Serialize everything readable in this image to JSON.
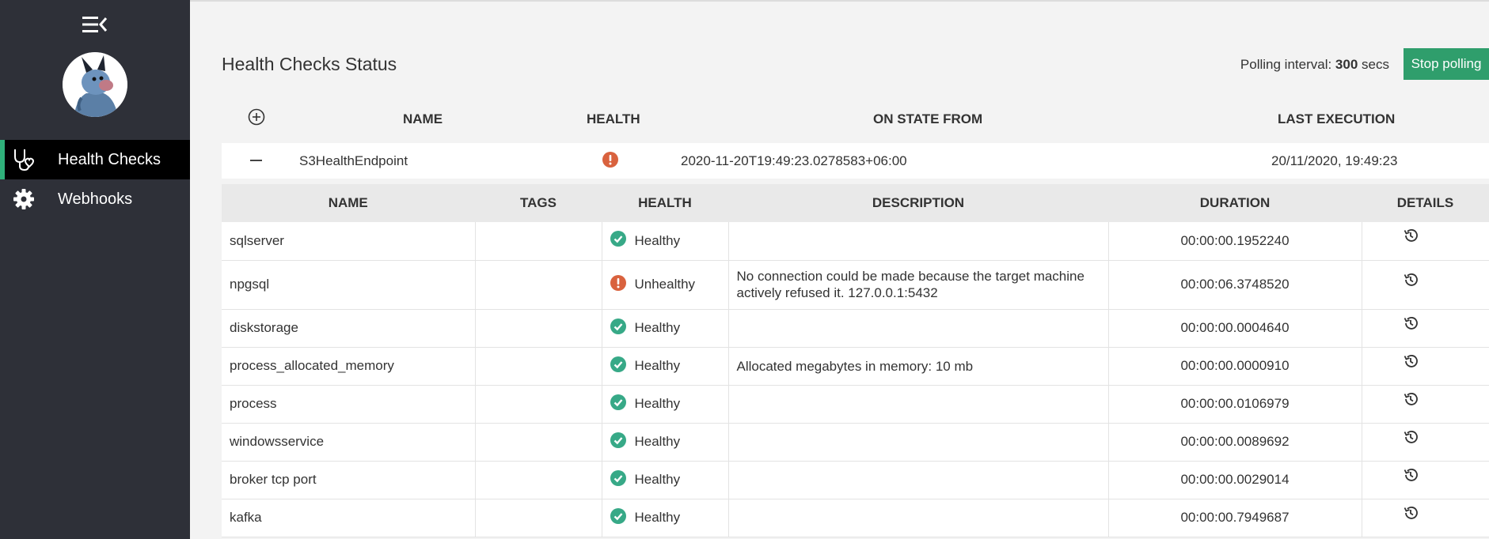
{
  "sidebar": {
    "menu_icon": "menu-collapse-icon",
    "avatar_icon": "avatar-mascot",
    "items": [
      {
        "label": "Health Checks",
        "icon": "stethoscope-icon",
        "active": true
      },
      {
        "label": "Webhooks",
        "icon": "gear-icon",
        "active": false
      }
    ]
  },
  "header": {
    "title": "Health Checks Status",
    "polling_label": "Polling interval:",
    "polling_value": "300",
    "polling_unit": "secs",
    "stop_button": "Stop polling"
  },
  "columns": {
    "name": "NAME",
    "health": "HEALTH",
    "on_state_from": "ON STATE FROM",
    "last_execution": "LAST EXECUTION"
  },
  "endpoint": {
    "name": "S3HealthEndpoint",
    "health_icon": "error-icon",
    "on_state_from": "2020-11-20T19:49:23.0278583+06:00",
    "last_execution": "20/11/2020, 19:49:23"
  },
  "detail": {
    "headers": {
      "name": "NAME",
      "tags": "TAGS",
      "health": "HEALTH",
      "description": "DESCRIPTION",
      "duration": "DURATION",
      "details": "DETAILS"
    },
    "rows": [
      {
        "name": "sqlserver",
        "tags": "",
        "health": "Healthy",
        "description": "",
        "duration": "00:00:00.1952240"
      },
      {
        "name": "npgsql",
        "tags": "",
        "health": "Unhealthy",
        "description": "No connection could be made because the target machine actively refused it. 127.0.0.1:5432",
        "duration": "00:00:06.3748520"
      },
      {
        "name": "diskstorage",
        "tags": "",
        "health": "Healthy",
        "description": "",
        "duration": "00:00:00.0004640"
      },
      {
        "name": "process_allocated_memory",
        "tags": "",
        "health": "Healthy",
        "description": "Allocated megabytes in memory: 10 mb",
        "duration": "00:00:00.0000910"
      },
      {
        "name": "process",
        "tags": "",
        "health": "Healthy",
        "description": "",
        "duration": "00:00:00.0106979"
      },
      {
        "name": "windowsservice",
        "tags": "",
        "health": "Healthy",
        "description": "",
        "duration": "00:00:00.0089692"
      },
      {
        "name": "broker tcp port",
        "tags": "",
        "health": "Healthy",
        "description": "",
        "duration": "00:00:00.0029014"
      },
      {
        "name": "kafka",
        "tags": "",
        "health": "Healthy",
        "description": "",
        "duration": "00:00:00.7949687"
      }
    ]
  },
  "colors": {
    "sidebar_bg": "#2e3038",
    "active_accent": "#2fb07a",
    "button_green": "#2f9e6c",
    "healthy": "#37a987",
    "unhealthy": "#d9623e"
  }
}
